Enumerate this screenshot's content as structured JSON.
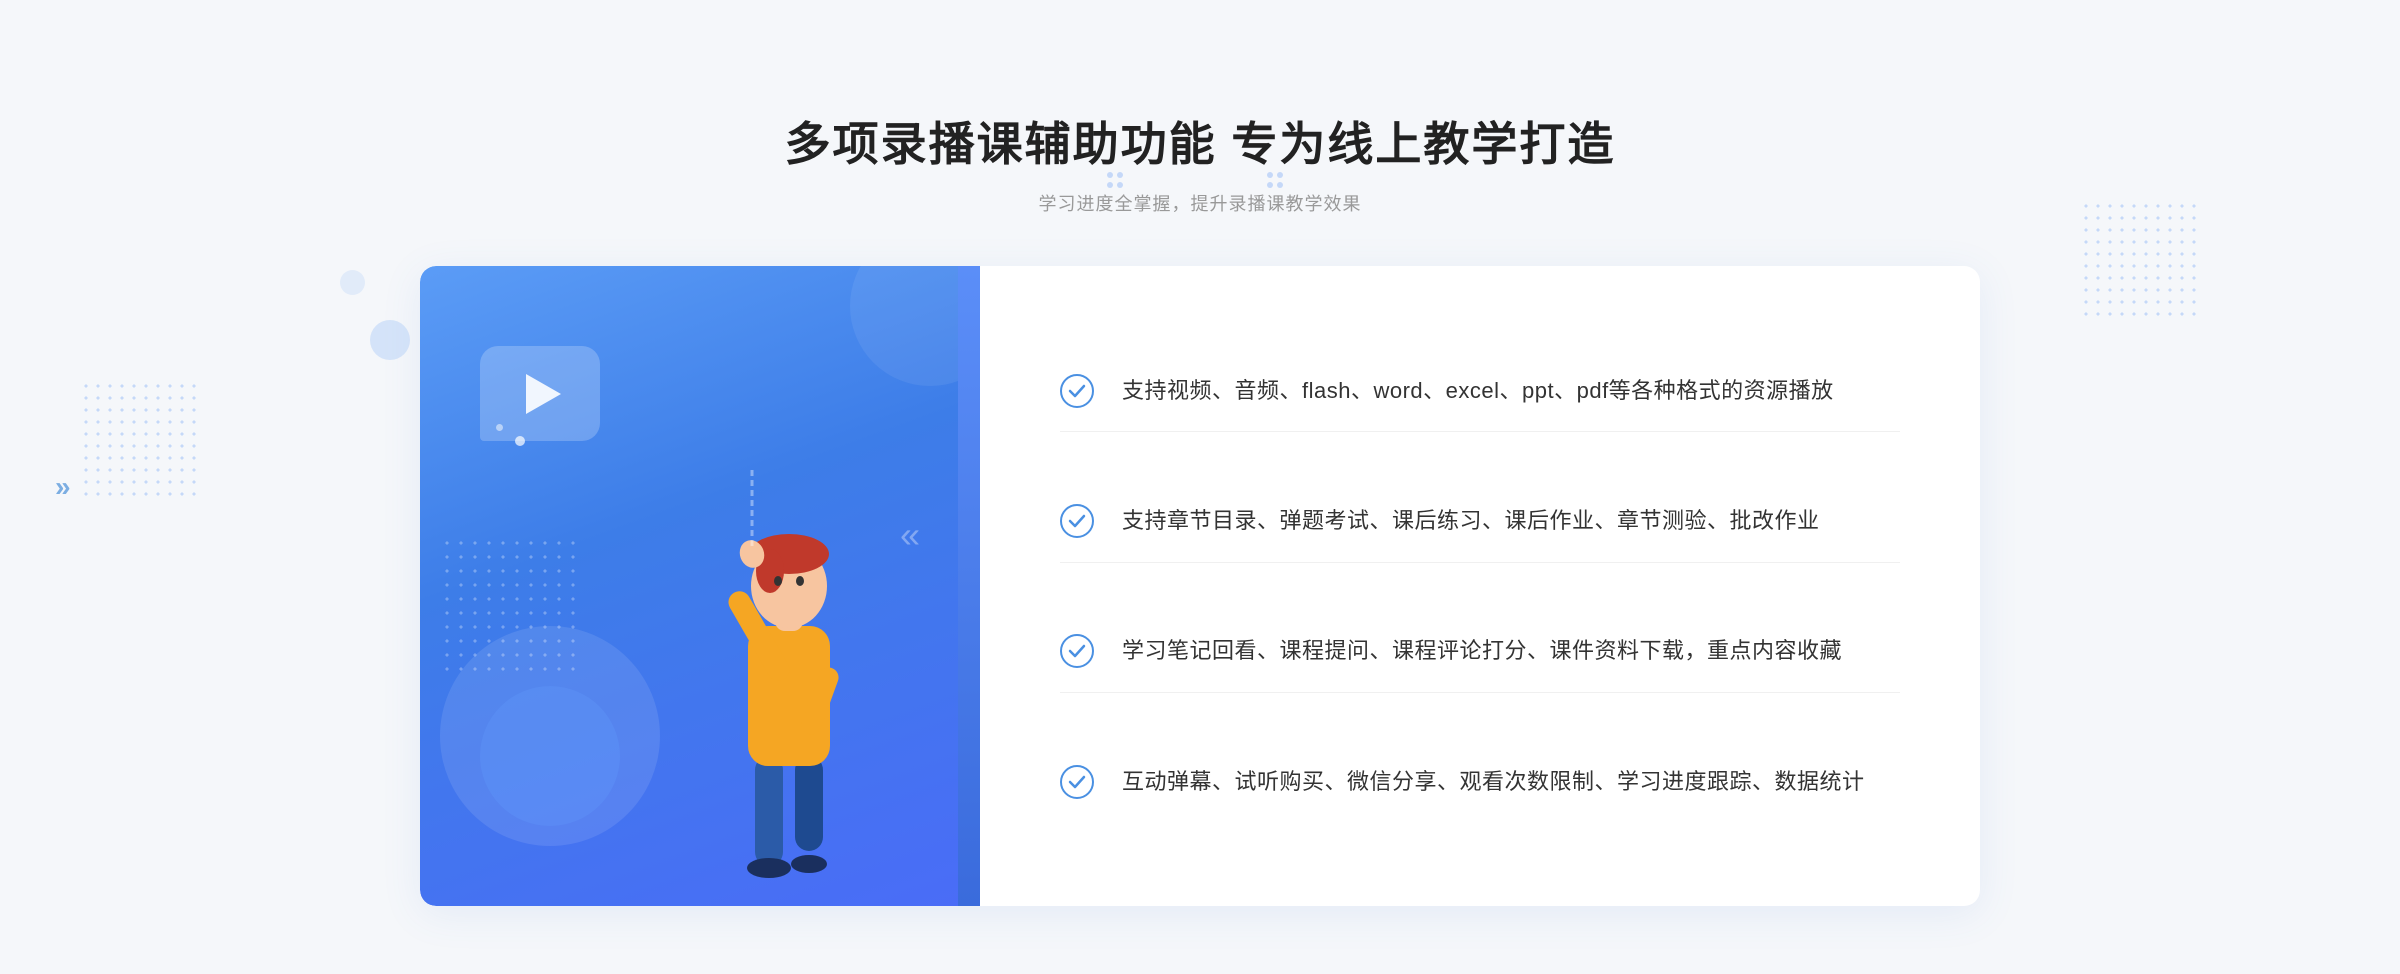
{
  "header": {
    "title": "多项录播课辅助功能 专为线上教学打造",
    "subtitle": "学习进度全掌握，提升录播课教学效果",
    "dots_left": "⁚",
    "dots_right": "⁚"
  },
  "features": [
    {
      "id": 1,
      "text": "支持视频、音频、flash、word、excel、ppt、pdf等各种格式的资源播放"
    },
    {
      "id": 2,
      "text": "支持章节目录、弹题考试、课后练习、课后作业、章节测验、批改作业"
    },
    {
      "id": 3,
      "text": "学习笔记回看、课程提问、课程评论打分、课件资料下载，重点内容收藏"
    },
    {
      "id": 4,
      "text": "互动弹幕、试听购买、微信分享、观看次数限制、学习进度跟踪、数据统计"
    }
  ],
  "decoration": {
    "chevron": "»",
    "chevron_inner": "«"
  }
}
